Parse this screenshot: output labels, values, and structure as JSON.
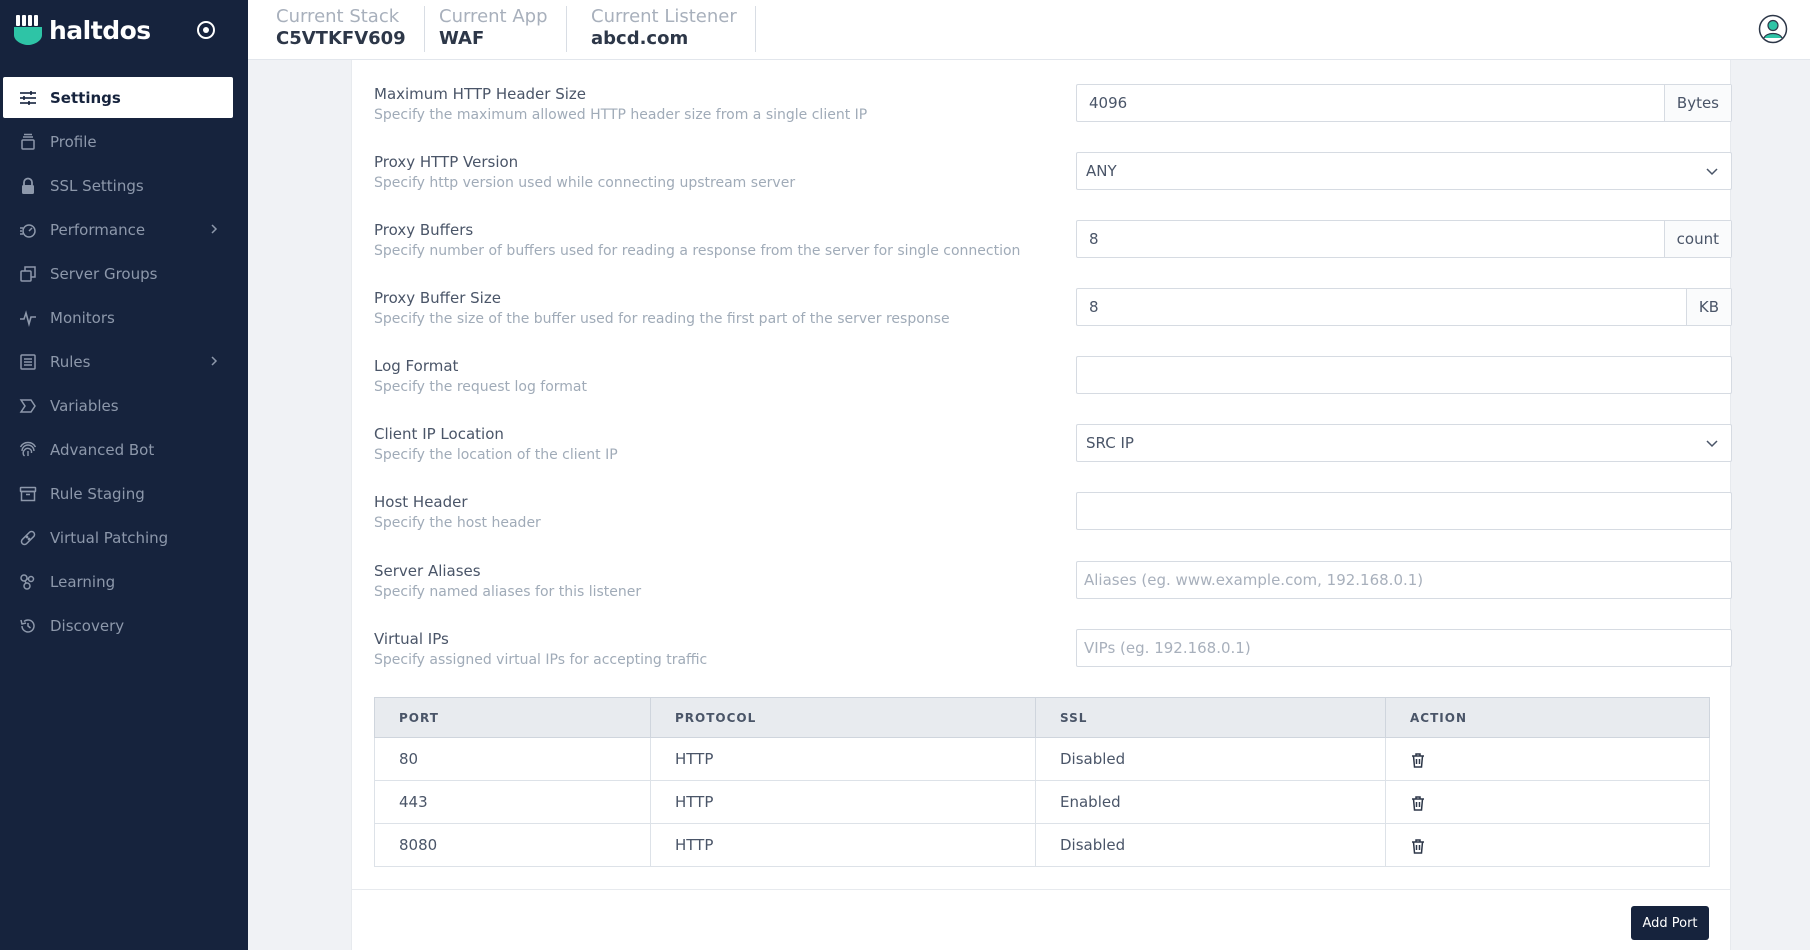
{
  "brand": {
    "name": "haltdos",
    "accent": "#2ec4a6"
  },
  "sidebar": {
    "items": [
      {
        "label": "Settings",
        "icon": "sliders-icon",
        "active": true
      },
      {
        "label": "Profile",
        "icon": "stack-icon"
      },
      {
        "label": "SSL Settings",
        "icon": "lock-icon"
      },
      {
        "label": "Performance",
        "icon": "speedometer-icon",
        "has_submenu": true
      },
      {
        "label": "Server Groups",
        "icon": "copy-icon"
      },
      {
        "label": "Monitors",
        "icon": "pulse-icon"
      },
      {
        "label": "Rules",
        "icon": "list-icon",
        "has_submenu": true
      },
      {
        "label": "Variables",
        "icon": "sigma-icon"
      },
      {
        "label": "Advanced Bot",
        "icon": "fingerprint-icon"
      },
      {
        "label": "Rule Staging",
        "icon": "archive-icon"
      },
      {
        "label": "Virtual Patching",
        "icon": "bandage-icon"
      },
      {
        "label": "Learning",
        "icon": "nodes-icon"
      },
      {
        "label": "Discovery",
        "icon": "history-icon"
      }
    ]
  },
  "topbar": {
    "stack": {
      "label": "Current Stack",
      "value": "C5VTKFV609"
    },
    "app": {
      "label": "Current App",
      "value": "WAF"
    },
    "listener": {
      "label": "Current Listener",
      "value": "abcd.com"
    }
  },
  "settings": {
    "max_header": {
      "title": "Maximum HTTP Header Size",
      "desc": "Specify the maximum allowed HTTP header size from a single client IP",
      "value": "4096",
      "unit": "Bytes"
    },
    "proxy_http_version": {
      "title": "Proxy HTTP Version",
      "desc": "Specify http version used while connecting upstream server",
      "value": "ANY"
    },
    "proxy_buffers": {
      "title": "Proxy Buffers",
      "desc": "Specify number of buffers used for reading a response from the server for single connection",
      "value": "8",
      "unit": "count"
    },
    "proxy_buffer_size": {
      "title": "Proxy Buffer Size",
      "desc": "Specify the size of the buffer used for reading the first part of the server response",
      "value": "8",
      "unit": "KB"
    },
    "log_format": {
      "title": "Log Format",
      "desc": "Specify the request log format",
      "value": ""
    },
    "client_ip_location": {
      "title": "Client IP Location",
      "desc": "Specify the location of the client IP",
      "value": "SRC IP"
    },
    "host_header": {
      "title": "Host Header",
      "desc": "Specify the host header",
      "value": ""
    },
    "server_aliases": {
      "title": "Server Aliases",
      "desc": "Specify named aliases for this listener",
      "placeholder": "Aliases (eg. www.example.com, 192.168.0.1)"
    },
    "virtual_ips": {
      "title": "Virtual IPs",
      "desc": "Specify assigned virtual IPs for accepting traffic",
      "placeholder": "VIPs (eg. 192.168.0.1)"
    }
  },
  "ports_table": {
    "headers": [
      "PORT",
      "PROTOCOL",
      "SSL",
      "ACTION"
    ],
    "rows": [
      {
        "port": "80",
        "protocol": "HTTP",
        "ssl": "Disabled"
      },
      {
        "port": "443",
        "protocol": "HTTP",
        "ssl": "Enabled"
      },
      {
        "port": "8080",
        "protocol": "HTTP",
        "ssl": "Disabled"
      }
    ]
  },
  "actions": {
    "add_port": "Add Port"
  }
}
